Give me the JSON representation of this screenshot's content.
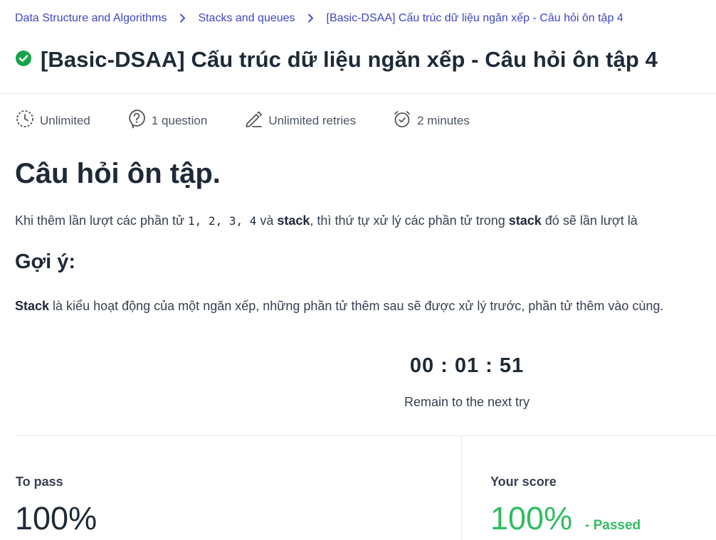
{
  "breadcrumb": {
    "items": [
      "Data Structure and Algorithms",
      "Stacks and queues",
      "[Basic-DSAA] Cấu trúc dữ liệu ngăn xếp - Câu hỏi ôn tập 4"
    ]
  },
  "header": {
    "title": "[Basic-DSAA] Cấu trúc dữ liệu ngăn xếp - Câu hỏi ôn tập 4",
    "status_icon": "check-circle-icon",
    "status_color": "#16a34a"
  },
  "meta": {
    "time_limit": "Unlimited",
    "questions": "1 question",
    "retries": "Unlimited retries",
    "duration": "2 minutes"
  },
  "content": {
    "heading": "Câu hỏi ôn tập.",
    "question_prefix": "Khi thêm lần lượt các phần tử ",
    "question_code": "1, 2, 3, 4",
    "question_mid1": " và ",
    "question_bold1": "stack",
    "question_mid2": ", thì thứ tự xử lý các phần tử trong ",
    "question_bold2": "stack",
    "question_suffix": " đó sẽ lần lượt là",
    "hint_heading": "Gợi ý:",
    "hint_bold": "Stack",
    "hint_text": " là kiểu hoạt động của một ngăn xếp, những phần tử thêm sau sẽ được xử lý trước, phần tử thêm vào cùng."
  },
  "timer": {
    "value": "00 : 01 : 51",
    "label": "Remain to the next try"
  },
  "result": {
    "pass_label": "To pass",
    "pass_value": "100%",
    "score_label": "Your score",
    "score_value": "100%",
    "score_status": "- Passed",
    "pass_color": "#2ebd5f"
  }
}
